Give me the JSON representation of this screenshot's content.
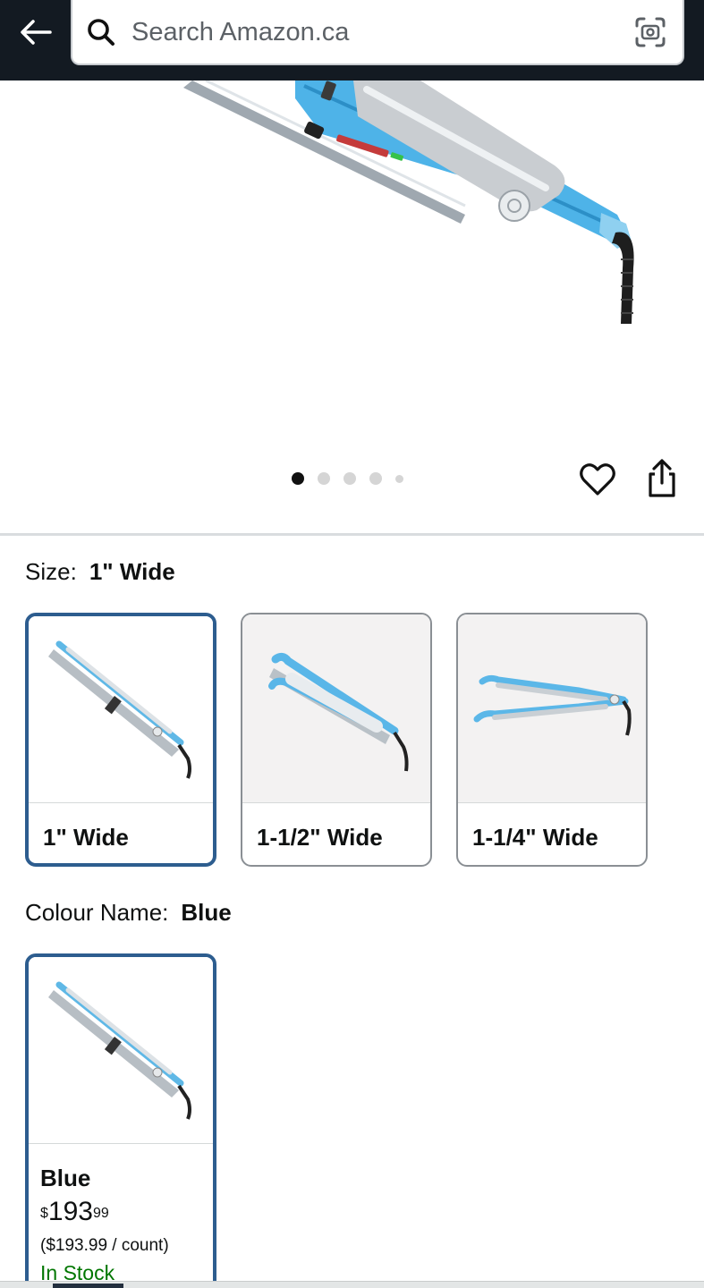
{
  "header": {
    "search_placeholder": "Search Amazon.ca",
    "icons": {
      "back": "back-arrow-icon",
      "search": "search-icon",
      "camera": "camera-scan-icon"
    }
  },
  "gallery": {
    "image_count": 5,
    "active_index": 0,
    "icons": {
      "wishlist": "heart-icon",
      "share": "share-icon"
    }
  },
  "size": {
    "label": "Size:",
    "selected": "1\" Wide",
    "options": [
      {
        "label": "1\" Wide"
      },
      {
        "label": "1-1/2\" Wide"
      },
      {
        "label": "1-1/4\" Wide"
      }
    ]
  },
  "colour": {
    "label": "Colour Name:",
    "selected": "Blue",
    "options": [
      {
        "name": "Blue",
        "price_symbol": "$",
        "price_whole": "193",
        "price_fraction": "99",
        "unit_price": "($193.99 / count)",
        "availability": "In Stock"
      }
    ]
  },
  "colors": {
    "header_bg": "#131a22",
    "selected_border": "#2d5d8f",
    "in_stock": "#007600"
  }
}
